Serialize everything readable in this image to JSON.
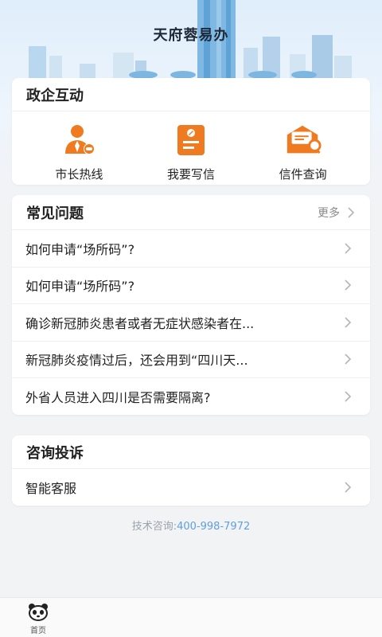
{
  "header": {
    "app_title": "天府蓉易办"
  },
  "interaction": {
    "title": "政企互动",
    "actions": [
      {
        "label": "市长热线",
        "icon": "mayor-hotline-icon"
      },
      {
        "label": "我要写信",
        "icon": "write-letter-icon"
      },
      {
        "label": "信件查询",
        "icon": "letter-query-icon"
      }
    ]
  },
  "faq": {
    "title": "常见问题",
    "more_label": "更多",
    "items": [
      "如何申请“场所码”?",
      "如何申请“场所码”?",
      "确诊新冠肺炎患者或者无症状感染者在...",
      "新冠肺炎疫情过后，还会用到“四川天...",
      "外省人员进入四川是否需要隔离?"
    ]
  },
  "consult": {
    "title": "咨询投诉",
    "items": [
      "智能客服"
    ]
  },
  "footer": {
    "tech_label": "技术咨询:",
    "tech_phone": "400-998-7972"
  },
  "tabbar": {
    "home_label": "首页",
    "home_icon": "panda-icon"
  },
  "colors": {
    "accent_orange": "#f07a1f",
    "link_blue": "#5f9fe0",
    "background": "#f2f3f5"
  }
}
